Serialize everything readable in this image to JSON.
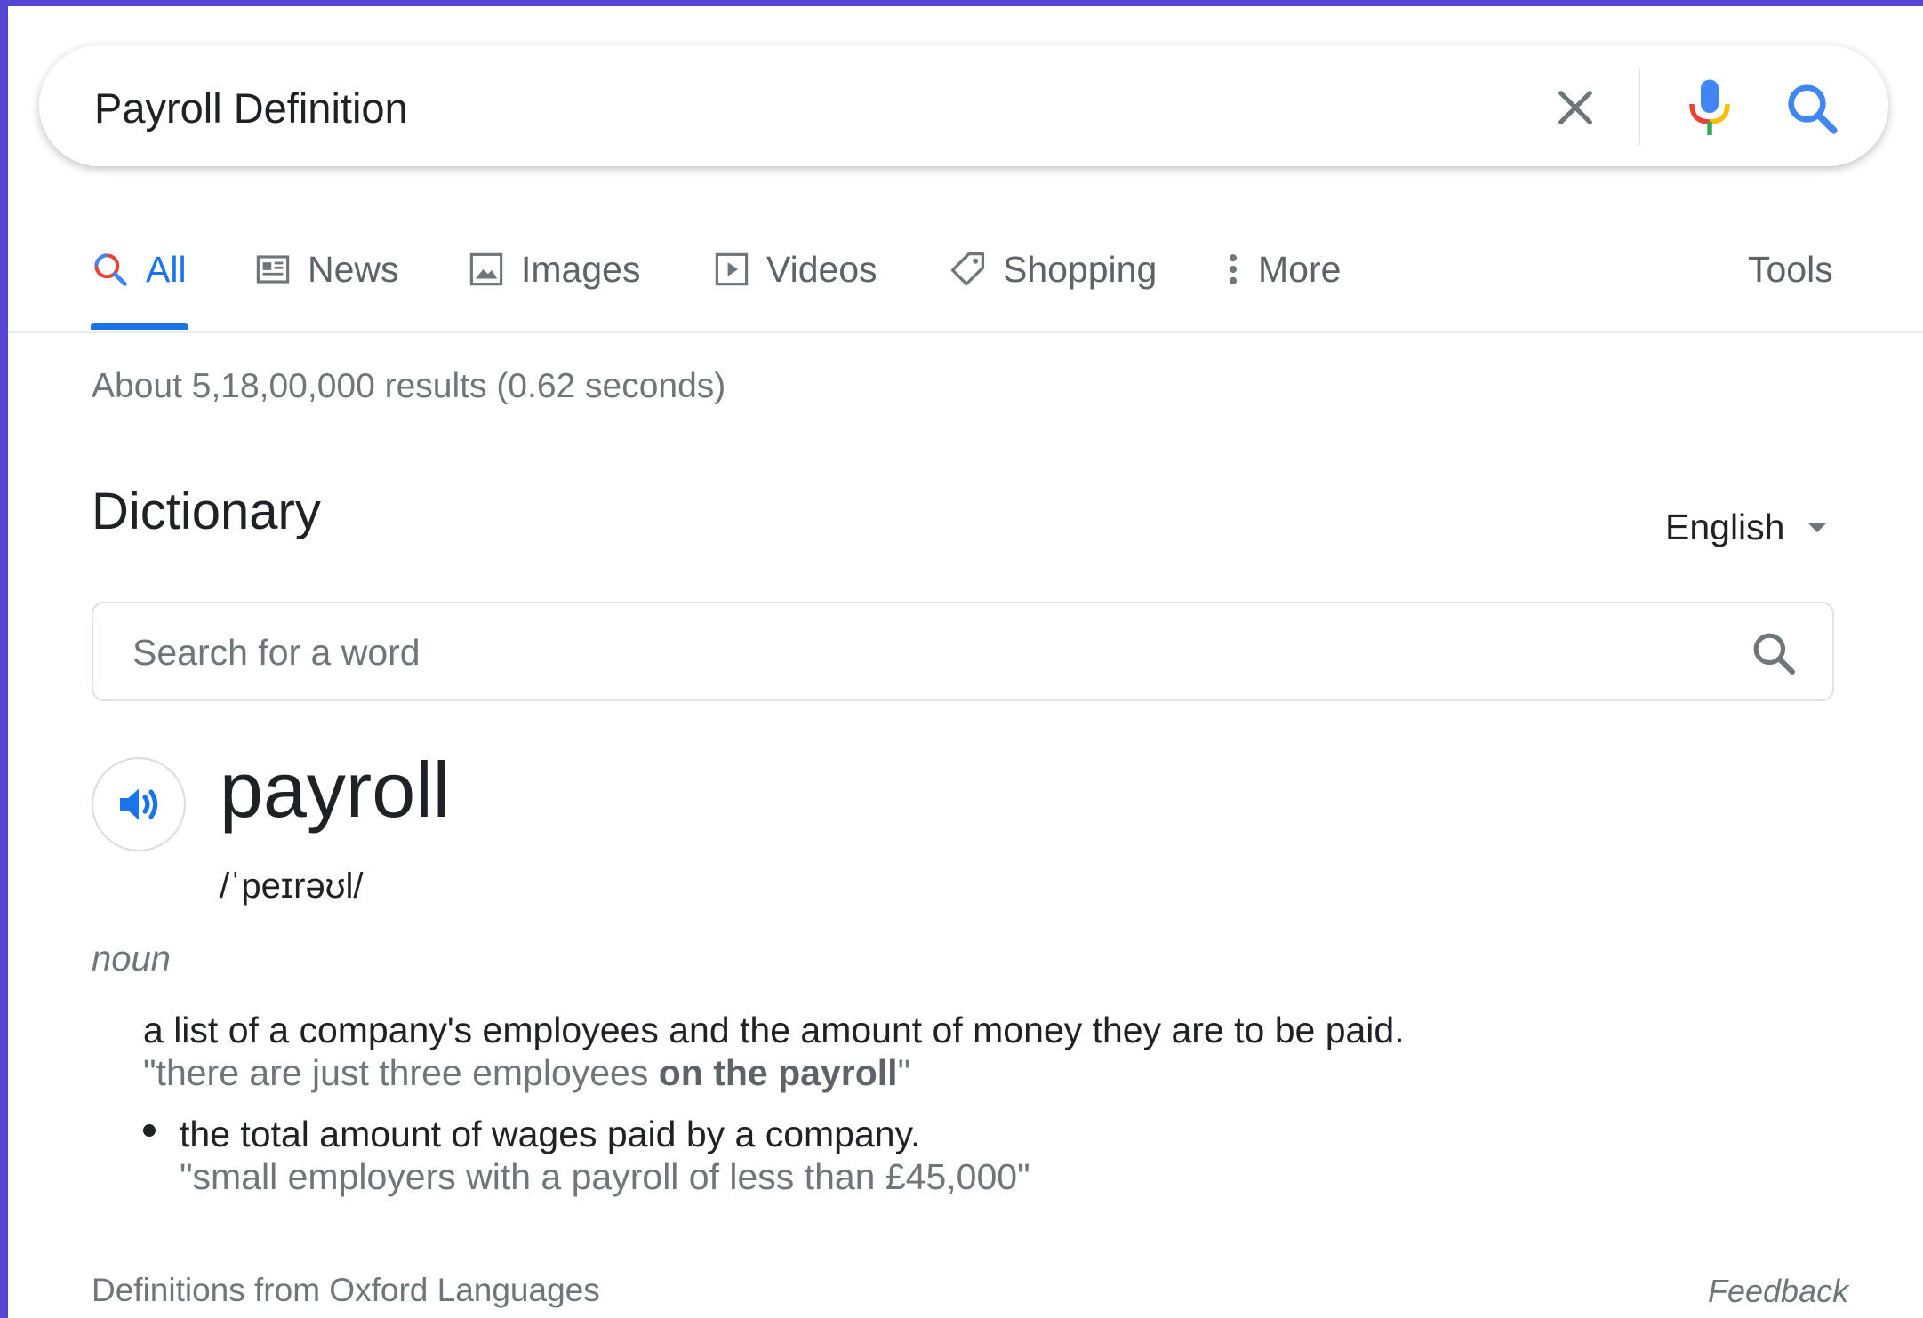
{
  "search": {
    "query": "Payroll Definition"
  },
  "tabs": [
    {
      "label": "All",
      "icon": "search-icon",
      "active": true
    },
    {
      "label": "News",
      "icon": "news-icon"
    },
    {
      "label": "Images",
      "icon": "image-icon"
    },
    {
      "label": "Videos",
      "icon": "play-icon"
    },
    {
      "label": "Shopping",
      "icon": "tag-icon"
    },
    {
      "label": "More",
      "icon": "vertical-dots-icon"
    }
  ],
  "tools_label": "Tools",
  "result_stats": "About 5,18,00,000 results (0.62 seconds)",
  "dictionary": {
    "title": "Dictionary",
    "language": "English",
    "search_placeholder": "Search for a word",
    "word": "payroll",
    "pronunciation": "/ˈpeɪrəʊl/",
    "part_of_speech": "noun",
    "definitions": [
      {
        "text": "a list of a company's employees and the amount of money they are to be paid.",
        "example_pre": "\"there are just three employees ",
        "example_bold": "on the payroll",
        "example_post": "\""
      },
      {
        "text": "the total amount of wages paid by a company.",
        "example": "\"small employers with a payroll of less than £45,000\""
      }
    ],
    "source": "Definitions from Oxford Languages",
    "feedback": "Feedback"
  },
  "colors": {
    "accent": "#1a73e8",
    "frame": "#5546d6"
  }
}
